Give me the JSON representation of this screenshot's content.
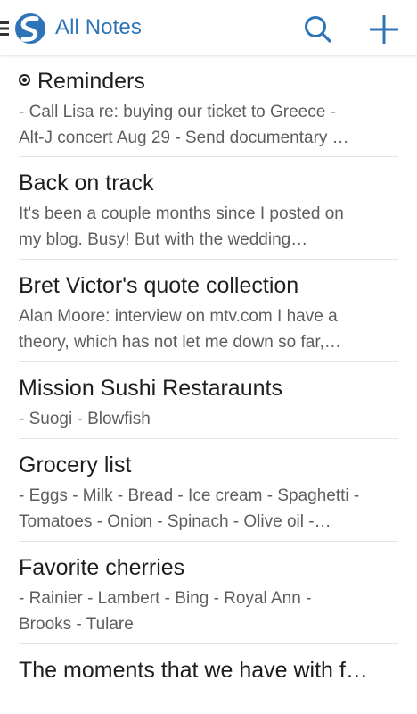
{
  "toolbar": {
    "title": "All Notes",
    "icons": [
      "menu-icon",
      "evernote-logo-icon",
      "search-icon",
      "plus-icon"
    ],
    "accent_color": "#2e74b8"
  },
  "notes": [
    {
      "title": "Reminders",
      "has_reminder": true,
      "snippet_lines": [
        "- Call Lisa re: buying our ticket to Greece -",
        "Alt-J concert Aug 29 - Send documentary …"
      ]
    },
    {
      "title": "Back on track",
      "has_reminder": false,
      "snippet_lines": [
        "It's been a couple months since I posted on",
        "my blog. Busy! But with the wedding…"
      ]
    },
    {
      "title": "Bret Victor's quote collection",
      "has_reminder": false,
      "snippet_lines": [
        "Alan Moore: interview on mtv.com I have a",
        "theory, which has not let me down so far,…"
      ]
    },
    {
      "title": "Mission Sushi Restaraunts",
      "has_reminder": false,
      "snippet_lines": [
        "- Suogi - Blowfish"
      ]
    },
    {
      "title": "Grocery list",
      "has_reminder": false,
      "snippet_lines": [
        "- Eggs - Milk - Bread - Ice cream - Spaghetti -",
        "Tomatoes - Onion - Spinach - Olive oil -…"
      ]
    },
    {
      "title": "Favorite cherries",
      "has_reminder": false,
      "snippet_lines": [
        "- Rainier - Lambert - Bing - Royal Ann -",
        "Brooks - Tulare"
      ]
    },
    {
      "title": "The moments that we have with f…",
      "has_reminder": false,
      "snippet_lines": []
    }
  ]
}
